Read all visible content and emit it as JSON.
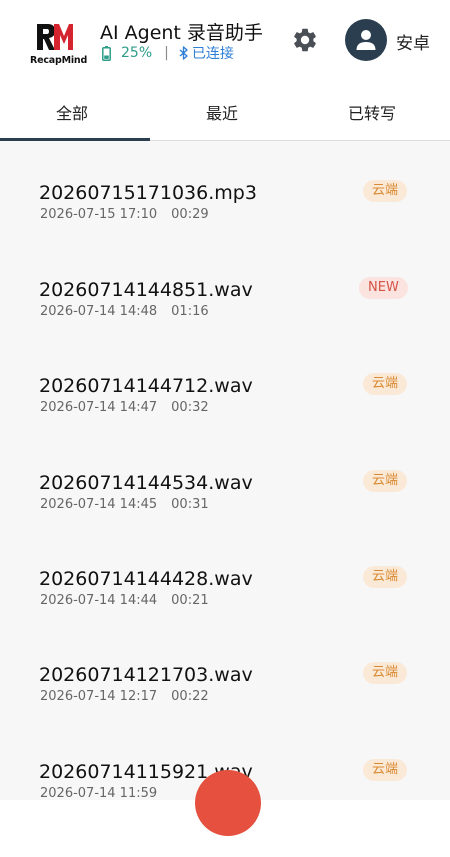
{
  "header": {
    "logo_mark": "RM",
    "logo_text": "RecapMind",
    "title": "AI Agent 录音助手",
    "battery": "25%",
    "connection": "已连接",
    "username": "安卓"
  },
  "tabs": [
    {
      "label": "全部",
      "active": true
    },
    {
      "label": "最近",
      "active": false
    },
    {
      "label": "已转写",
      "active": false
    }
  ],
  "recordings": [
    {
      "name": "20260715171036.mp3",
      "date": "2026-07-15 17:10",
      "duration": "00:29",
      "badge": "云端",
      "badge_type": "cloud"
    },
    {
      "name": "20260714144851.wav",
      "date": "2026-07-14 14:48",
      "duration": "01:16",
      "badge": "NEW",
      "badge_type": "new"
    },
    {
      "name": "20260714144712.wav",
      "date": "2026-07-14 14:47",
      "duration": "00:32",
      "badge": "云端",
      "badge_type": "cloud"
    },
    {
      "name": "20260714144534.wav",
      "date": "2026-07-14 14:45",
      "duration": "00:31",
      "badge": "云端",
      "badge_type": "cloud"
    },
    {
      "name": "20260714144428.wav",
      "date": "2026-07-14 14:44",
      "duration": "00:21",
      "badge": "云端",
      "badge_type": "cloud"
    },
    {
      "name": "20260714121703.wav",
      "date": "2026-07-14 12:17",
      "duration": "00:22",
      "badge": "云端",
      "badge_type": "cloud"
    },
    {
      "name": "20260714115921.wav",
      "date": "2026-07-14 11:59",
      "duration": "",
      "badge": "云端",
      "badge_type": "cloud"
    }
  ],
  "colors": {
    "accent": "#2a3e4f",
    "battery": "#2e9d8a",
    "bluetooth": "#2f7fd6",
    "cloud_badge_bg": "#fbe9d8",
    "cloud_badge_text": "#d8892f",
    "new_badge_bg": "#fbe3e0",
    "new_badge_text": "#d65545",
    "fab": "#e5503f"
  },
  "icons": {
    "battery": "battery-icon",
    "bluetooth": "bluetooth-icon",
    "settings": "gear-icon",
    "avatar": "user-icon"
  }
}
